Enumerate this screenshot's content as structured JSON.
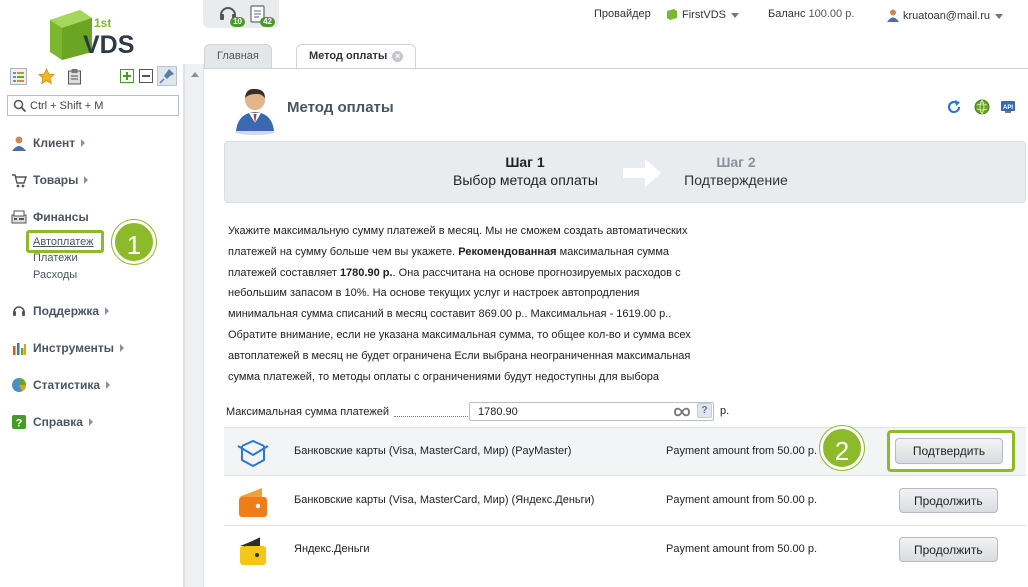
{
  "logo": {
    "text": "VDS",
    "superscript": "1st"
  },
  "notifications": [
    {
      "icon": "headset-icon",
      "count": "10"
    },
    {
      "icon": "document-icon",
      "count": "42"
    }
  ],
  "topbar": {
    "provider_label": "Провайдер",
    "provider_value": "FirstVDS",
    "balance_label": "Баланс",
    "balance_value": "100.00 р.",
    "user": "kruatoan@mail.ru"
  },
  "sidebar": {
    "search_placeholder": "Ctrl + Shift + M",
    "menu": [
      {
        "label": "Клиент",
        "icon": "client-icon"
      },
      {
        "label": "Товары",
        "icon": "cart-icon"
      },
      {
        "label": "Финансы",
        "icon": "finance-icon"
      },
      {
        "label": "Поддержка",
        "icon": "support-icon"
      },
      {
        "label": "Инструменты",
        "icon": "tools-icon"
      },
      {
        "label": "Статистика",
        "icon": "statistics-icon"
      },
      {
        "label": "Справка",
        "icon": "help-icon"
      }
    ],
    "finance_sub": [
      "Автоплатеж",
      "Платежи",
      "Расходы"
    ]
  },
  "callouts": [
    "1",
    "2"
  ],
  "tabs": [
    {
      "label": "Главная",
      "active": false
    },
    {
      "label": "Метод оплаты",
      "active": true
    }
  ],
  "page": {
    "title": "Метод оплаты",
    "wizard": {
      "step1_title": "Шаг 1",
      "step1_desc": "Выбор метода оплаты",
      "step2_title": "Шаг 2",
      "step2_desc": "Подтверждение"
    },
    "info": {
      "p1": "Укажите максимальную сумму платежей в месяц. Мы не сможем создать автоматических платежей на сумму больше чем вы укажете. ",
      "p1_bold": "Рекомендованная",
      "p2": " максимальная сумма платежей составляет ",
      "p2_bold": "1780.90 р.",
      "p3": ". Она рассчитана на основе прогнозируемых расходов с небольшим запасом в 10%. На основе текущих услуг и настроек автопродления минимальная сумма списаний в месяц составит 869.00 р.. Максимальная - 1619.00 р.. Обратите внимание, если не указана максимальная сумма, то общее кол-во и сумма всех автоплатежей в месяц не будет ограничена Если выбрана неограниченная максимальная сумма платежей, то методы оплаты с ограничениями будут недоступны для выбора"
    },
    "max_label": "Максимальная сумма платежей",
    "max_value": "1780.90",
    "help": "?",
    "unit": "р.",
    "payments": [
      {
        "name": "Банковские карты (Visa, MasterCard, Мир) (PayMaster)",
        "amount": "Payment amount from 50.00 р.",
        "button": "Подтвердить",
        "icon": "paymaster-icon"
      },
      {
        "name": "Банковские карты (Visa, MasterCard, Мир) (Яндекс.Деньги)",
        "amount": "Payment amount from 50.00 р.",
        "button": "Продолжить",
        "icon": "yandex-money-icon"
      },
      {
        "name": "Яндекс.Деньги",
        "amount": "Payment amount from 50.00 р.",
        "button": "Продолжить",
        "icon": "yandex-wallet-icon"
      }
    ]
  },
  "colors": {
    "accent_green": "#8dba2a",
    "logo_green": "#7cb82f"
  }
}
